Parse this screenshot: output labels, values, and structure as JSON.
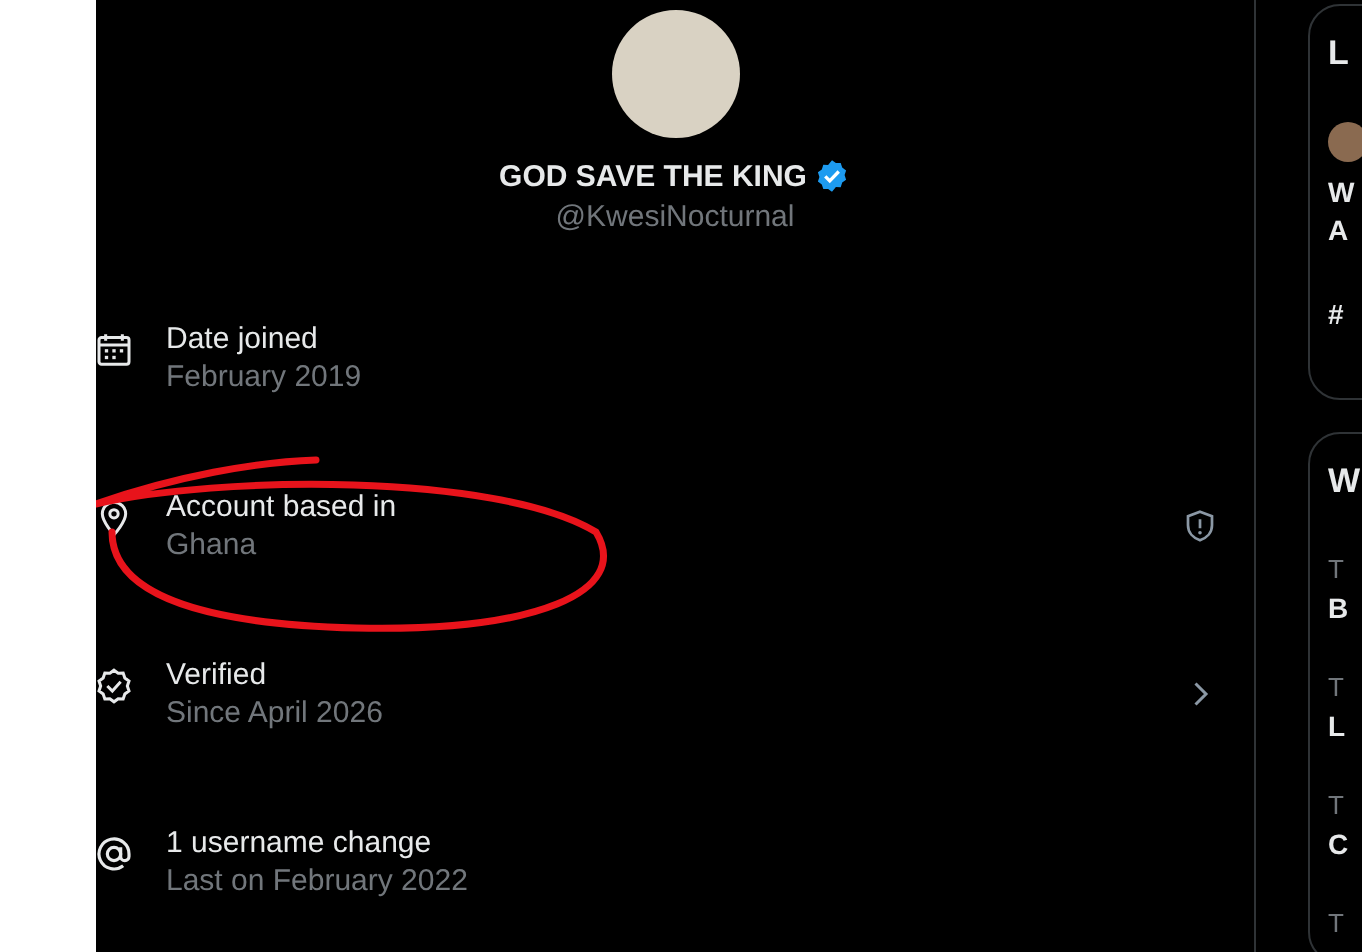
{
  "profile": {
    "display_name": "GOD SAVE THE KING",
    "verified": true,
    "handle": "@KwesiNocturnal"
  },
  "details": [
    {
      "kind": "calendar",
      "title": "Date joined",
      "value": "February 2019"
    },
    {
      "kind": "location",
      "title": "Account based in",
      "value": "Ghana",
      "alert": true
    },
    {
      "kind": "verified",
      "title": "Verified",
      "value": "Since April 2026",
      "link": true
    },
    {
      "kind": "username",
      "title": "1 username change",
      "value": "Last on February 2022"
    }
  ],
  "sidebar_cards": [
    {
      "heading": "L",
      "post": {
        "lines": [
          "W",
          "A"
        ],
        "tag": "#"
      }
    },
    {
      "heading": "W",
      "items": [
        {
          "category": "T",
          "title": "B"
        },
        {
          "category": "T",
          "title": "L"
        },
        {
          "category": "T",
          "title": "C"
        },
        {
          "category": "T"
        }
      ]
    }
  ]
}
